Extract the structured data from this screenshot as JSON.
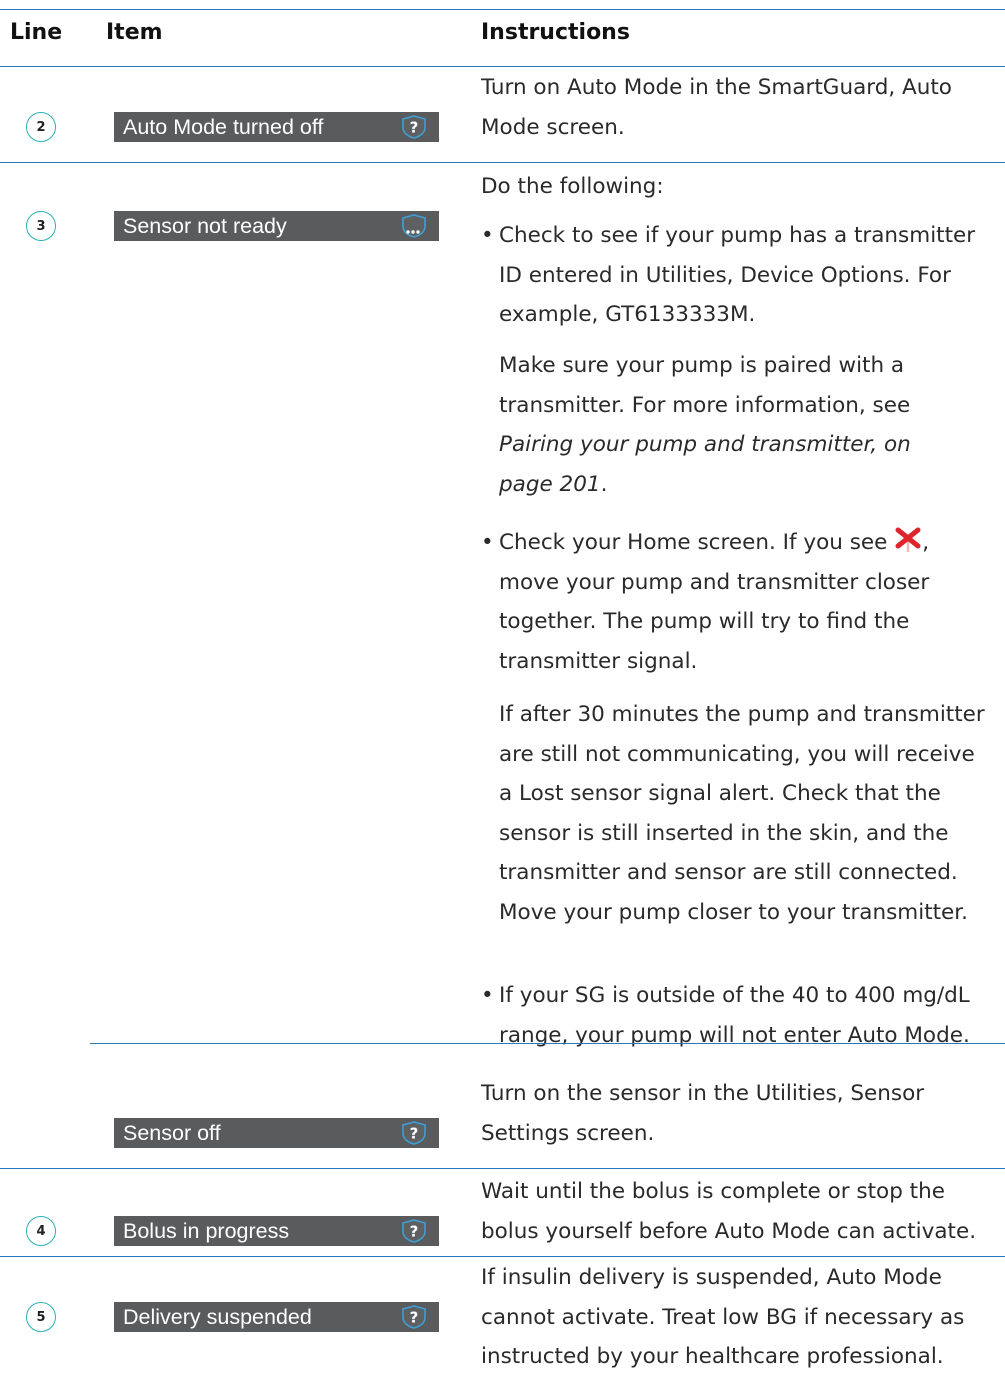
{
  "header": {
    "line": "Line",
    "item": "Item",
    "instructions": "Instructions"
  },
  "rows": [
    {
      "line": "2",
      "item": "Auto Mode turned off",
      "icon": "question-shield-icon",
      "text": "Turn on Auto Mode in the SmartGuard, Auto Mode screen."
    },
    {
      "line": "3",
      "item": "Sensor not ready",
      "icon": "waiting-shield-icon",
      "intro": "Do the following:",
      "bullet1": "Check to see if your pump has a transmitter ID entered in Utilities, Device Options. For example, GT6133333M.",
      "para1_text": "Make sure your pump is paired with a transmitter. For more information, see",
      "para1_link": "Pairing your pump and transmitter, on page 201",
      "para1_end": ".",
      "bullet2_a": "Check your Home screen. If you see",
      "bullet2_icon": "lost-signal-icon",
      "bullet2_b": ", move your pump and transmitter closer together. The pump will try to find the transmitter signal.",
      "para2": "If after 30 minutes the pump and transmitter are still not communicating, you will receive a Lost sensor signal alert. Check that the sensor is still inserted in the skin, and the transmitter and sensor are still connected. Move your pump closer to your transmitter.",
      "bullet3": "If your SG is outside of the 40 to 400 mg/dL range, your pump will not enter Auto Mode."
    },
    {
      "line": "",
      "item": "Sensor off",
      "icon": "question-shield-icon",
      "text": "Turn on the sensor in the Utilities, Sensor Settings screen."
    },
    {
      "line": "4",
      "item": "Bolus in progress",
      "icon": "question-shield-icon",
      "text": "Wait until the bolus is complete or stop the bolus yourself before Auto Mode can activate."
    },
    {
      "line": "5",
      "item": "Delivery suspended",
      "icon": "question-shield-icon",
      "text": "If insulin delivery is suspended, Auto Mode cannot activate. Treat low BG if necessary as instructed by your healthcare professional."
    }
  ],
  "colors": {
    "rule": "#2a78b8",
    "circle": "#2bb1b5",
    "status_bg": "#595b5d",
    "shield": "#3f9fd2",
    "x_red": "#e0242c"
  }
}
